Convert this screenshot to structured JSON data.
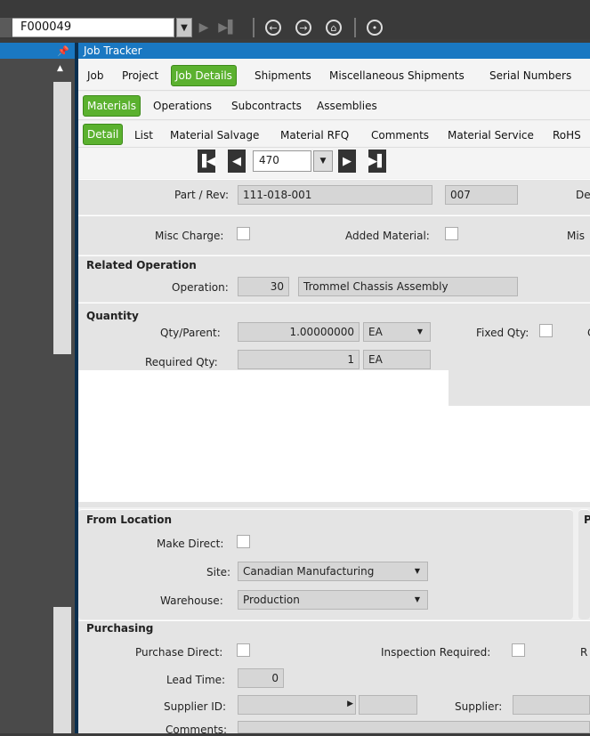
{
  "toolbar": {
    "job_value": "F000049"
  },
  "window": {
    "title": "Job Tracker"
  },
  "tabs_level1": [
    "Job",
    "Project",
    "Job Details",
    "Shipments",
    "Miscellaneous Shipments",
    "Serial Numbers"
  ],
  "tabs_level2": [
    "Materials",
    "Operations",
    "Subcontracts",
    "Assemblies"
  ],
  "tabs_level3": [
    "Detail",
    "List",
    "Material Salvage",
    "Material RFQ",
    "Comments",
    "Material Service",
    "RoHS"
  ],
  "nav": {
    "record": "470"
  },
  "part": {
    "label": "Part / Rev:",
    "part_value": "111-018-001",
    "rev_value": "007",
    "desc_label_partial": "De"
  },
  "misc": {
    "misc_charge_label": "Misc Charge:",
    "added_material_label": "Added Material:",
    "misc_partial": "Mis"
  },
  "related_operation": {
    "header": "Related Operation",
    "operation_label": "Operation:",
    "operation_num": "30",
    "operation_desc": "Trommel Chassis Assembly"
  },
  "quantity": {
    "header": "Quantity",
    "qty_parent_label": "Qty/Parent:",
    "qty_parent_value": "1.00000000",
    "qty_parent_uom": "EA",
    "fixed_qty_label": "Fixed Qty:",
    "fixed_partial": "C",
    "required_qty_label": "Required Qty:",
    "required_qty_value": "1",
    "required_qty_uom": "EA"
  },
  "from_location": {
    "header": "From Location",
    "make_direct_label": "Make Direct:",
    "site_label": "Site:",
    "site_value": "Canadian Manufacturing",
    "warehouse_label": "Warehouse:",
    "warehouse_value": "Production",
    "right_partial": "P"
  },
  "purchasing": {
    "header": "Purchasing",
    "purchase_direct_label": "Purchase Direct:",
    "inspection_label": "Inspection  Required:",
    "right_partial": "R",
    "lead_time_label": "Lead Time:",
    "lead_time_value": "0",
    "supplier_id_label": "Supplier ID:",
    "supplier_label": "Supplier:",
    "comments_label": "Comments:"
  },
  "colors": {
    "accent_blue": "#1a78c2",
    "active_tab_green": "#5bb12f"
  }
}
